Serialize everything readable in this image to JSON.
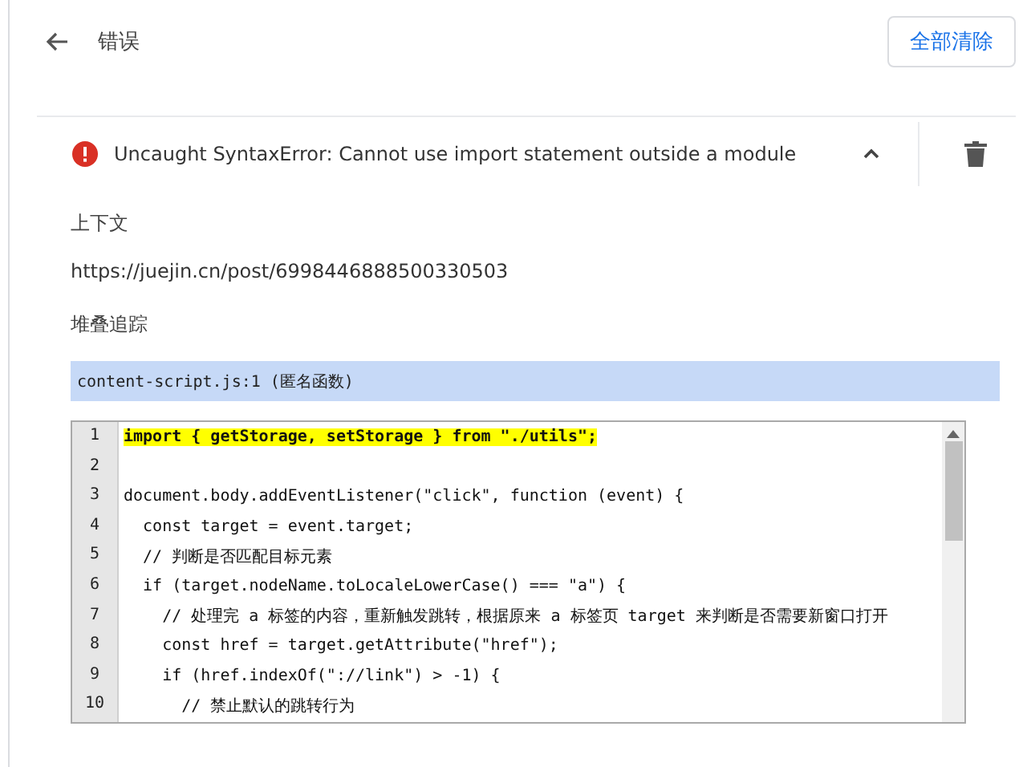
{
  "header": {
    "title": "错误",
    "clear_button": "全部清除"
  },
  "error": {
    "message": "Uncaught SyntaxError: Cannot use import statement outside a module",
    "expanded": true
  },
  "context": {
    "label": "上下文",
    "url": "https://juejin.cn/post/6998446888500330503"
  },
  "stack": {
    "label": "堆叠追踪",
    "frames": [
      {
        "text": "content-script.js:1 (匿名函数)",
        "selected": true
      }
    ]
  },
  "code": {
    "lines": [
      {
        "number": "1",
        "text": "import { getStorage, setStorage } from \"./utils\";",
        "highlighted": true
      },
      {
        "number": "2",
        "highlighted": false
      },
      {
        "number": "3",
        "text": "document.body.addEventListener(\"click\", function (event) {",
        "highlighted": false
      },
      {
        "number": "4",
        "text": "  const target = event.target;",
        "highlighted": false
      },
      {
        "number": "5",
        "text": "  // 判断是否匹配目标元素",
        "highlighted": false
      },
      {
        "number": "6",
        "text": "  if (target.nodeName.toLocaleLowerCase() === \"a\") {",
        "highlighted": false
      },
      {
        "number": "7",
        "text": "    // 处理完 a 标签的内容，重新触发跳转，根据原来 a 标签页 target 来判断是否需要新窗口打开",
        "highlighted": false
      },
      {
        "number": "8",
        "text": "    const href = target.getAttribute(\"href\");",
        "highlighted": false
      },
      {
        "number": "9",
        "text": "    if (href.indexOf(\"://link\") > -1) {",
        "highlighted": false
      },
      {
        "number": "10",
        "text": "      // 禁止默认的跳转行为",
        "highlighted": false
      }
    ]
  }
}
